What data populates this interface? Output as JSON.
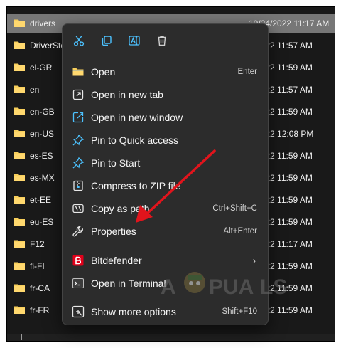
{
  "files": [
    {
      "name": "drivers",
      "date": "10/24/2022 11:17 AM",
      "selected": true
    },
    {
      "name": "DriverStore",
      "date": "1/2022 11:57 AM"
    },
    {
      "name": "el-GR",
      "date": "1/2022 11:59 AM"
    },
    {
      "name": "en",
      "date": "1/2022 11:57 AM"
    },
    {
      "name": "en-GB",
      "date": "1/2022 11:59 AM"
    },
    {
      "name": "en-US",
      "date": "1/2022 12:08 PM"
    },
    {
      "name": "es-ES",
      "date": "1/2022 11:59 AM"
    },
    {
      "name": "es-MX",
      "date": "1/2022 11:59 AM"
    },
    {
      "name": "et-EE",
      "date": "1/2022 11:59 AM"
    },
    {
      "name": "eu-ES",
      "date": "1/2022 11:59 AM"
    },
    {
      "name": "F12",
      "date": "1/2022 11:17 AM"
    },
    {
      "name": "fi-FI",
      "date": "1/2022 11:59 AM"
    },
    {
      "name": "fr-CA",
      "date": "1/2022 11:59 AM"
    },
    {
      "name": "fr-FR",
      "date": "1/2022 11:59 AM"
    }
  ],
  "quick_actions": [
    "cut-icon",
    "copy-icon",
    "rename-icon",
    "delete-icon"
  ],
  "menu": {
    "open": {
      "label": "Open",
      "shortcut": "Enter"
    },
    "open_new_tab": {
      "label": "Open in new tab"
    },
    "open_new_window": {
      "label": "Open in new window"
    },
    "pin_quick": {
      "label": "Pin to Quick access"
    },
    "pin_start": {
      "label": "Pin to Start"
    },
    "compress": {
      "label": "Compress to ZIP file"
    },
    "copy_path": {
      "label": "Copy as path",
      "shortcut": "Ctrl+Shift+C"
    },
    "properties": {
      "label": "Properties",
      "shortcut": "Alt+Enter"
    },
    "bitdefender": {
      "label": "Bitdefender"
    },
    "terminal": {
      "label": "Open in Terminal"
    },
    "show_more": {
      "label": "Show more options",
      "shortcut": "Shift+F10"
    }
  },
  "watermark": {
    "text": "A  PUALS"
  },
  "colors": {
    "accent": "#4cc2ff",
    "folder": "#f8cf5b",
    "arrow": "#e1141c",
    "bitdefender": "#e2001a"
  }
}
